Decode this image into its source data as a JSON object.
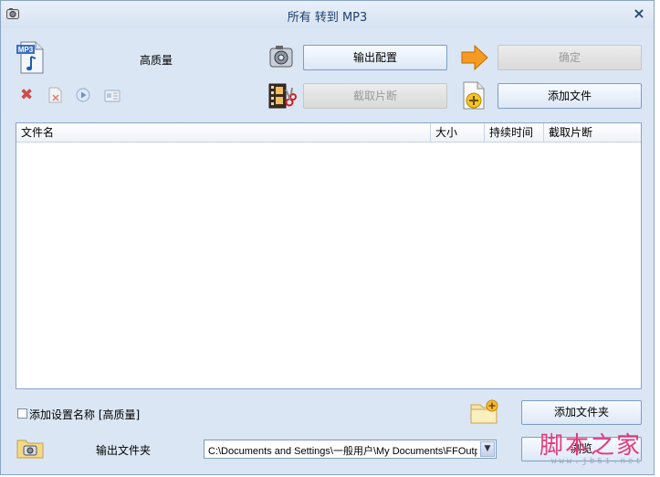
{
  "window": {
    "title": "所有 转到 MP3",
    "close_glyph": "×"
  },
  "format": {
    "icon_text": "MP3",
    "quality_label": "高质量"
  },
  "buttons": {
    "output_config": "输出配置",
    "confirm": "确定",
    "clip": "截取片断",
    "add_file": "添加文件",
    "add_folder": "添加文件夹",
    "browse": "浏览"
  },
  "file_list": {
    "columns": [
      "文件名",
      "大小",
      "持续时间",
      "截取片断"
    ],
    "rows": []
  },
  "options": {
    "add_setting_name_label": "添加设置名称 [高质量]",
    "add_setting_name_checked": false
  },
  "output": {
    "folder_label": "输出文件夹",
    "path": "C:\\Documents and Settings\\一般用户\\My Documents\\FFOutp",
    "dropdown_glyph": "▼"
  },
  "watermark": {
    "text": "脚本之家",
    "url": "www.jb51.net"
  },
  "colors": {
    "window_bg": "#dbe6f4",
    "accent_border": "#7c9cc6",
    "title_text": "#1e3f6e",
    "watermark": "#e33a7c"
  }
}
